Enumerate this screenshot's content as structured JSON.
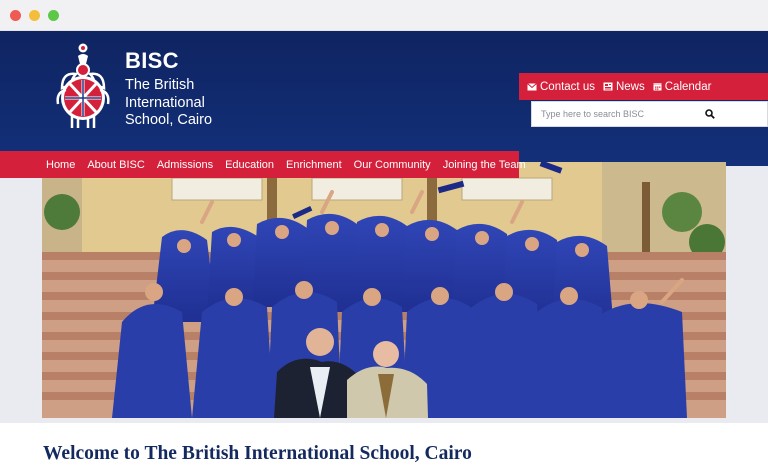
{
  "brand": {
    "name": "BISC",
    "line1": "The British",
    "line2": "International",
    "line3": "School, Cairo"
  },
  "utility": {
    "contact_label": "Contact us",
    "news_label": "News",
    "calendar_label": "Calendar"
  },
  "search": {
    "placeholder": "Type here to search BISC"
  },
  "nav": {
    "items": [
      "Home",
      "About BISC",
      "Admissions",
      "Education",
      "Enrichment",
      "Our Community",
      "Joining the Team"
    ]
  },
  "hero": {
    "icon": "graduation-photo"
  },
  "welcome": {
    "heading": "Welcome to The British International School, Cairo"
  },
  "colors": {
    "navy": "#13307a",
    "red": "#d4203a",
    "heading": "#142a5e"
  }
}
